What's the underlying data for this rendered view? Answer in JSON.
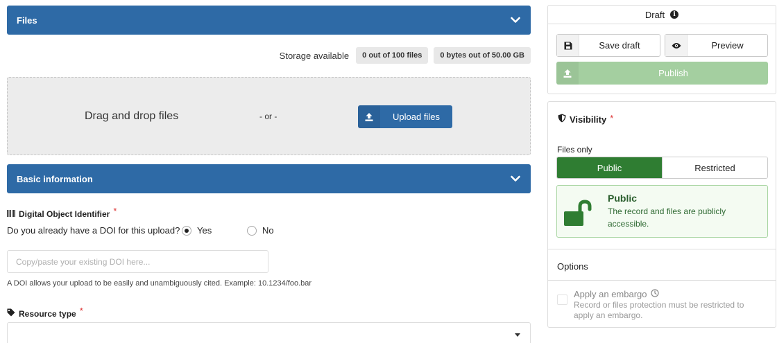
{
  "files_section": {
    "title": "Files"
  },
  "storage": {
    "label": "Storage available",
    "files_pill": "0 out of 100 files",
    "bytes_pill": "0 bytes out of 50.00 GB"
  },
  "dropzone": {
    "text": "Drag and drop files",
    "or": "- or -",
    "upload_label": "Upload files"
  },
  "basic_section": {
    "title": "Basic information"
  },
  "doi": {
    "label": "Digital Object Identifier",
    "required_mark": "*",
    "question": "Do you already have a DOI for this upload?",
    "yes_label": "Yes",
    "no_label": "No",
    "selected": "Yes",
    "input_placeholder": "Copy/paste your existing DOI here...",
    "input_value": "",
    "help": "A DOI allows your upload to be easily and unambiguously cited. Example: 10.1234/foo.bar"
  },
  "resource_type": {
    "label": "Resource type",
    "required_mark": "*",
    "value": ""
  },
  "draft_card": {
    "title": "Draft",
    "save_label": "Save draft",
    "preview_label": "Preview",
    "publish_label": "Publish"
  },
  "visibility": {
    "title": "Visibility",
    "required_mark": "*",
    "files_only_label": "Files only",
    "public_label": "Public",
    "restricted_label": "Restricted",
    "selected": "Public",
    "box_heading": "Public",
    "box_desc": "The record and files are publicly accessible.",
    "options_label": "Options",
    "embargo_title": "Apply an embargo",
    "embargo_desc": "Record or files protection must be restricted to apply an embargo."
  },
  "colors": {
    "primary": "#2e6aa6",
    "success": "#2f7d32",
    "publish_disabled": "#a4cfa0",
    "danger": "#d33333"
  }
}
